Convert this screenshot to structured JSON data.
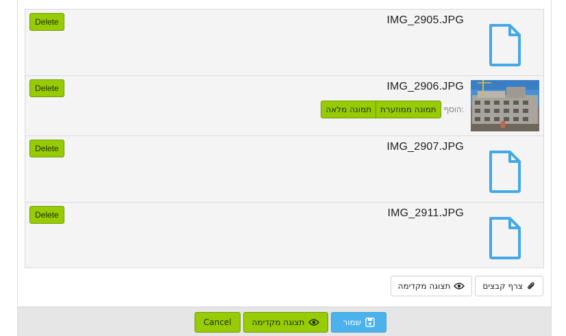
{
  "files": [
    {
      "name": "IMG_2905.JPG",
      "delete_label": "Delete",
      "thumb": "file-icon"
    },
    {
      "name": "IMG_2906.JPG",
      "delete_label": "Delete",
      "thumb": "photo",
      "add_label": "הוסף:",
      "insert_options": [
        "תמונה ממוזערת",
        "תמונה מלאה"
      ]
    },
    {
      "name": "IMG_2907.JPG",
      "delete_label": "Delete",
      "thumb": "file-icon"
    },
    {
      "name": "IMG_2911.JPG",
      "delete_label": "Delete",
      "thumb": "file-icon"
    }
  ],
  "toolbar": {
    "attach_label": "צרף קבצים",
    "attach_icon": "paperclip-icon",
    "preview_label": "תצוגה מקדימה",
    "preview_icon": "eye-icon"
  },
  "footer": {
    "save_label": "שמור",
    "save_icon": "floppy-icon",
    "preview_label": "תצוגה מקדימה",
    "preview_icon": "eye-icon",
    "cancel_label": "Cancel"
  },
  "colors": {
    "accent_green": "#97cc04",
    "accent_blue": "#4cb2ec",
    "file_icon_blue": "#45a8e6"
  }
}
